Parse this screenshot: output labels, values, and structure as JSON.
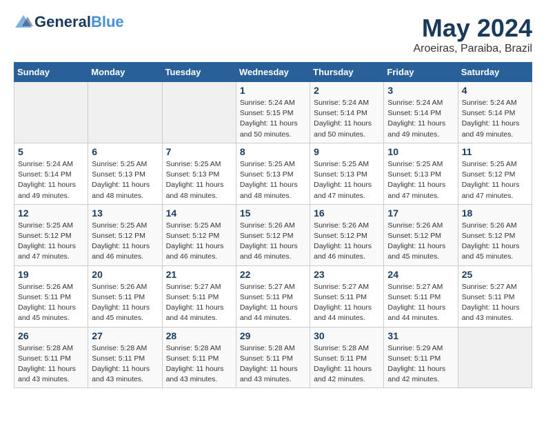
{
  "header": {
    "logo_line1_part1": "General",
    "logo_line1_part2": "Blue",
    "title": "May 2024",
    "subtitle": "Aroeiras, Paraiba, Brazil"
  },
  "weekdays": [
    "Sunday",
    "Monday",
    "Tuesday",
    "Wednesday",
    "Thursday",
    "Friday",
    "Saturday"
  ],
  "weeks": [
    [
      {
        "day": "",
        "info": ""
      },
      {
        "day": "",
        "info": ""
      },
      {
        "day": "",
        "info": ""
      },
      {
        "day": "1",
        "info": "Sunrise: 5:24 AM\nSunset: 5:15 PM\nDaylight: 11 hours\nand 50 minutes."
      },
      {
        "day": "2",
        "info": "Sunrise: 5:24 AM\nSunset: 5:14 PM\nDaylight: 11 hours\nand 50 minutes."
      },
      {
        "day": "3",
        "info": "Sunrise: 5:24 AM\nSunset: 5:14 PM\nDaylight: 11 hours\nand 49 minutes."
      },
      {
        "day": "4",
        "info": "Sunrise: 5:24 AM\nSunset: 5:14 PM\nDaylight: 11 hours\nand 49 minutes."
      }
    ],
    [
      {
        "day": "5",
        "info": "Sunrise: 5:24 AM\nSunset: 5:14 PM\nDaylight: 11 hours\nand 49 minutes."
      },
      {
        "day": "6",
        "info": "Sunrise: 5:25 AM\nSunset: 5:13 PM\nDaylight: 11 hours\nand 48 minutes."
      },
      {
        "day": "7",
        "info": "Sunrise: 5:25 AM\nSunset: 5:13 PM\nDaylight: 11 hours\nand 48 minutes."
      },
      {
        "day": "8",
        "info": "Sunrise: 5:25 AM\nSunset: 5:13 PM\nDaylight: 11 hours\nand 48 minutes."
      },
      {
        "day": "9",
        "info": "Sunrise: 5:25 AM\nSunset: 5:13 PM\nDaylight: 11 hours\nand 47 minutes."
      },
      {
        "day": "10",
        "info": "Sunrise: 5:25 AM\nSunset: 5:13 PM\nDaylight: 11 hours\nand 47 minutes."
      },
      {
        "day": "11",
        "info": "Sunrise: 5:25 AM\nSunset: 5:12 PM\nDaylight: 11 hours\nand 47 minutes."
      }
    ],
    [
      {
        "day": "12",
        "info": "Sunrise: 5:25 AM\nSunset: 5:12 PM\nDaylight: 11 hours\nand 47 minutes."
      },
      {
        "day": "13",
        "info": "Sunrise: 5:25 AM\nSunset: 5:12 PM\nDaylight: 11 hours\nand 46 minutes."
      },
      {
        "day": "14",
        "info": "Sunrise: 5:25 AM\nSunset: 5:12 PM\nDaylight: 11 hours\nand 46 minutes."
      },
      {
        "day": "15",
        "info": "Sunrise: 5:26 AM\nSunset: 5:12 PM\nDaylight: 11 hours\nand 46 minutes."
      },
      {
        "day": "16",
        "info": "Sunrise: 5:26 AM\nSunset: 5:12 PM\nDaylight: 11 hours\nand 46 minutes."
      },
      {
        "day": "17",
        "info": "Sunrise: 5:26 AM\nSunset: 5:12 PM\nDaylight: 11 hours\nand 45 minutes."
      },
      {
        "day": "18",
        "info": "Sunrise: 5:26 AM\nSunset: 5:12 PM\nDaylight: 11 hours\nand 45 minutes."
      }
    ],
    [
      {
        "day": "19",
        "info": "Sunrise: 5:26 AM\nSunset: 5:11 PM\nDaylight: 11 hours\nand 45 minutes."
      },
      {
        "day": "20",
        "info": "Sunrise: 5:26 AM\nSunset: 5:11 PM\nDaylight: 11 hours\nand 45 minutes."
      },
      {
        "day": "21",
        "info": "Sunrise: 5:27 AM\nSunset: 5:11 PM\nDaylight: 11 hours\nand 44 minutes."
      },
      {
        "day": "22",
        "info": "Sunrise: 5:27 AM\nSunset: 5:11 PM\nDaylight: 11 hours\nand 44 minutes."
      },
      {
        "day": "23",
        "info": "Sunrise: 5:27 AM\nSunset: 5:11 PM\nDaylight: 11 hours\nand 44 minutes."
      },
      {
        "day": "24",
        "info": "Sunrise: 5:27 AM\nSunset: 5:11 PM\nDaylight: 11 hours\nand 44 minutes."
      },
      {
        "day": "25",
        "info": "Sunrise: 5:27 AM\nSunset: 5:11 PM\nDaylight: 11 hours\nand 43 minutes."
      }
    ],
    [
      {
        "day": "26",
        "info": "Sunrise: 5:28 AM\nSunset: 5:11 PM\nDaylight: 11 hours\nand 43 minutes."
      },
      {
        "day": "27",
        "info": "Sunrise: 5:28 AM\nSunset: 5:11 PM\nDaylight: 11 hours\nand 43 minutes."
      },
      {
        "day": "28",
        "info": "Sunrise: 5:28 AM\nSunset: 5:11 PM\nDaylight: 11 hours\nand 43 minutes."
      },
      {
        "day": "29",
        "info": "Sunrise: 5:28 AM\nSunset: 5:11 PM\nDaylight: 11 hours\nand 43 minutes."
      },
      {
        "day": "30",
        "info": "Sunrise: 5:28 AM\nSunset: 5:11 PM\nDaylight: 11 hours\nand 42 minutes."
      },
      {
        "day": "31",
        "info": "Sunrise: 5:29 AM\nSunset: 5:11 PM\nDaylight: 11 hours\nand 42 minutes."
      },
      {
        "day": "",
        "info": ""
      }
    ]
  ]
}
